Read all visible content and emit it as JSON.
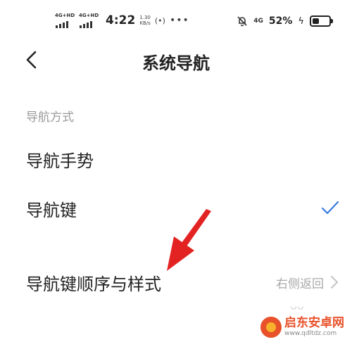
{
  "status_bar": {
    "sim1_network": "4G+HD",
    "sim2_network": "4G+HD",
    "time": "4:22",
    "speed_value": "1.30",
    "speed_unit": "KB/s",
    "hotspot_icon": "hotspot-icon",
    "more_notifications": "•••",
    "mute_icon": "bell-off-icon",
    "network_right": "4G",
    "battery_percent": "52%",
    "battery_level": 0.52,
    "charging_icon": "charging-icon"
  },
  "header": {
    "back_icon": "chevron-left-icon",
    "title": "系统导航"
  },
  "section": {
    "label": "导航方式"
  },
  "options": [
    {
      "label": "导航手势",
      "selected": false
    },
    {
      "label": "导航键",
      "selected": true
    }
  ],
  "order_row": {
    "label": "导航键顺序与样式",
    "value": "右侧返回",
    "chevron_icon": "chevron-right-icon"
  },
  "annotation": {
    "color": "#e32222",
    "icon": "red-arrow-icon"
  },
  "colors": {
    "accent": "#3a7be0",
    "secondary_text": "#9a9a9a"
  },
  "watermark": {
    "name": "启东安卓网",
    "url": "www.qdltdz.com"
  }
}
